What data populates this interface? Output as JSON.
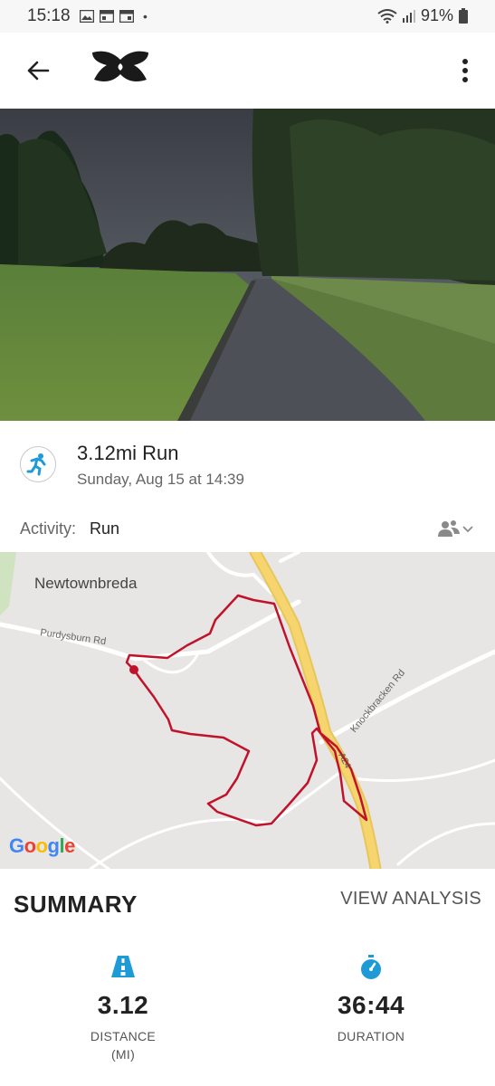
{
  "status_bar": {
    "time": "15:18",
    "dot": "•",
    "battery_percent": "91%"
  },
  "app_bar": {
    "back_icon": "arrow-left-icon",
    "logo": "under-armour-logo",
    "menu_icon": "more-vertical-icon"
  },
  "activity": {
    "title": "3.12mi Run",
    "date": "Sunday, Aug 15 at 14:39",
    "activity_label": "Activity:",
    "activity_value": "Run",
    "privacy_icon": "friends-privacy-icon"
  },
  "map": {
    "place_label": "Newtownbreda",
    "roads": [
      "Purdysburn Rd",
      "Knockbracken Rd",
      "A24"
    ],
    "attribution": "Google",
    "route_color": "#c0132b"
  },
  "summary": {
    "title": "SUMMARY",
    "view_analysis": "VIEW ANALYSIS",
    "stats": [
      {
        "icon": "road-icon",
        "value": "3.12",
        "label": "DISTANCE",
        "unit": "(MI)"
      },
      {
        "icon": "stopwatch-icon",
        "value": "36:44",
        "label": "DURATION",
        "unit": ""
      }
    ]
  },
  "colors": {
    "accent_blue": "#1e9bd7",
    "route_red": "#c0132b",
    "road_yellow": "#f6d46e"
  }
}
